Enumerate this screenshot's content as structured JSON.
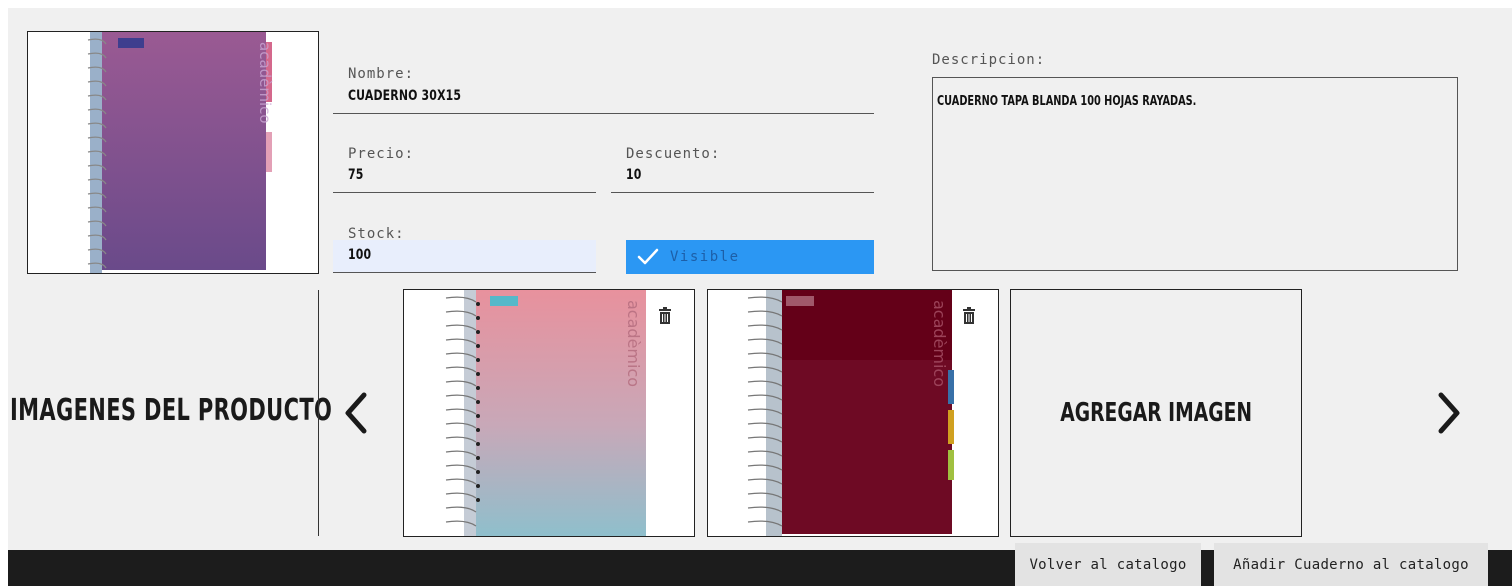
{
  "form": {
    "nombre_label": "Nombre:",
    "nombre_value": "CUADERNO 30X15",
    "precio_label": "Precio:",
    "precio_value": "75",
    "descuento_label": "Descuento:",
    "descuento_value": "10",
    "stock_label": "Stock:",
    "stock_value": "100",
    "visible_label": "Visible",
    "visible_checked": true,
    "descripcion_label": "Descripcion:",
    "descripcion_value": "CUADERNO TAPA BLANDA 100 HOJAS RAYADAS."
  },
  "gallery": {
    "title": "IMAGENES DEL PRODUCTO",
    "add_image_label": "AGREGAR IMAGEN",
    "images": [
      {
        "cover_top": "#e8919d",
        "cover_bottom": "#8fbfcc",
        "logo_color": "#56b8c9"
      },
      {
        "cover_top": "#640018",
        "cover_bottom": "#7d1f35",
        "logo_color": "#ffffff"
      }
    ]
  },
  "main_image": {
    "cover_top": "#9a5a93",
    "cover_bottom": "#6a4a8a",
    "logo_color": "#3e3e8e"
  },
  "footer": {
    "back_label": "Volver al catalogo",
    "add_label": "Añadir Cuaderno al catalogo"
  },
  "colors": {
    "accent": "#2b97f3",
    "panel_bg": "#f0f0f0",
    "footer_bg": "#1c1c1c"
  }
}
